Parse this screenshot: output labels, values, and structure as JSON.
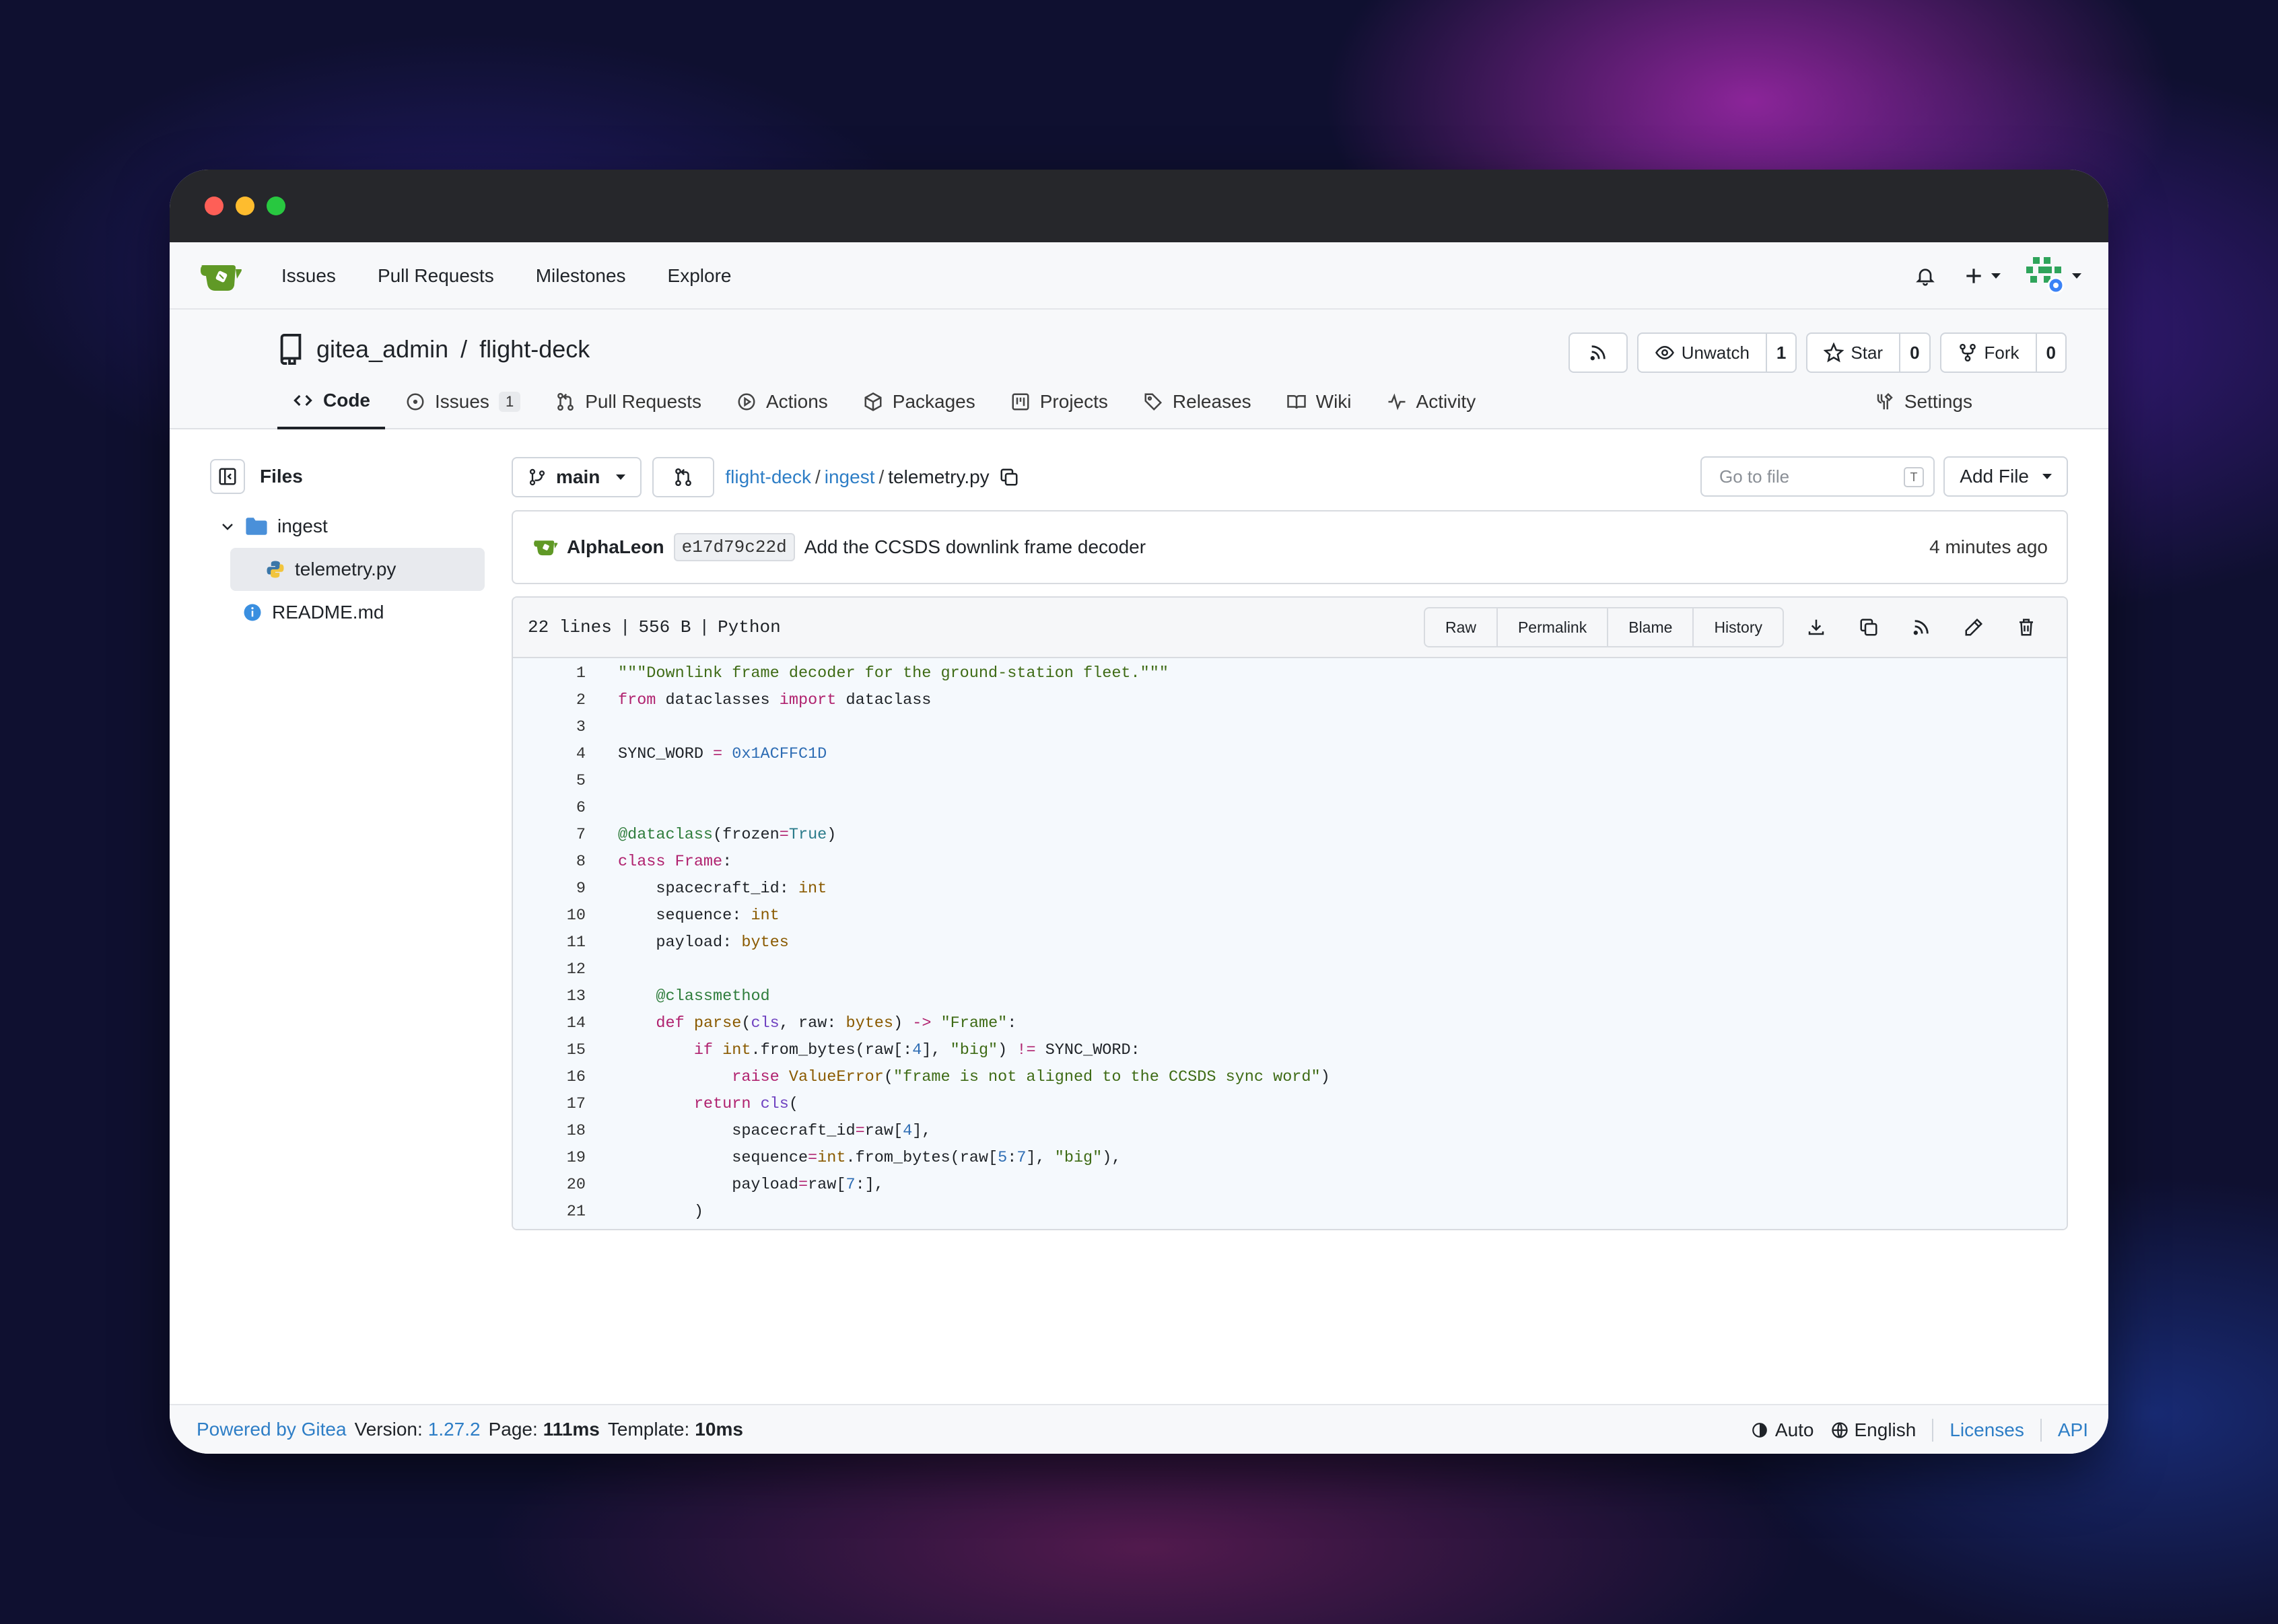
{
  "navbar": {
    "links": [
      "Issues",
      "Pull Requests",
      "Milestones",
      "Explore"
    ]
  },
  "repo": {
    "owner": "gitea_admin",
    "separator": "/",
    "name": "flight-deck",
    "actions": {
      "unwatch_label": "Unwatch",
      "unwatch_count": "1",
      "star_label": "Star",
      "star_count": "0",
      "fork_label": "Fork",
      "fork_count": "0"
    },
    "tabs": {
      "code": "Code",
      "issues": "Issues",
      "issues_count": "1",
      "pulls": "Pull Requests",
      "actions": "Actions",
      "packages": "Packages",
      "projects": "Projects",
      "releases": "Releases",
      "wiki": "Wiki",
      "activity": "Activity",
      "settings": "Settings"
    }
  },
  "files_panel": {
    "title": "Files",
    "folder": "ingest",
    "active_file": "telemetry.py",
    "readme": "README.md"
  },
  "toolbar": {
    "branch": "main",
    "crumbs": [
      "flight-deck",
      "ingest",
      "telemetry.py"
    ],
    "crumb_sep": "/",
    "goto_placeholder": "Go to file",
    "goto_key": "T",
    "add_file": "Add File"
  },
  "commit": {
    "author": "AlphaLeon",
    "sha": "e17d79c22d",
    "message": "Add the CCSDS downlink frame decoder",
    "time": "4 minutes ago"
  },
  "file": {
    "lines_info": "22 lines",
    "size": "556 B",
    "language": "Python",
    "buttons": [
      "Raw",
      "Permalink",
      "Blame",
      "History"
    ]
  },
  "code_lines": [
    "\"\"\"Downlink frame decoder for the ground-station fleet.\"\"\"",
    "from dataclasses import dataclass",
    "",
    "SYNC_WORD = 0x1ACFFC1D",
    "",
    "",
    "@dataclass(frozen=True)",
    "class Frame:",
    "    spacecraft_id: int",
    "    sequence: int",
    "    payload: bytes",
    "",
    "    @classmethod",
    "    def parse(cls, raw: bytes) -> \"Frame\":",
    "        if int.from_bytes(raw[:4], \"big\") != SYNC_WORD:",
    "            raise ValueError(\"frame is not aligned to the CCSDS sync word\")",
    "        return cls(",
    "            spacecraft_id=raw[4],",
    "            sequence=int.from_bytes(raw[5:7], \"big\"),",
    "            payload=raw[7:],",
    "        )"
  ],
  "footer": {
    "powered": "Powered by Gitea",
    "version_label": "Version:",
    "version": "1.27.2",
    "page_label": "Page:",
    "page_time": "111ms",
    "template_label": "Template:",
    "template_time": "10ms",
    "theme": "Auto",
    "language": "English",
    "licenses": "Licenses",
    "api": "API"
  },
  "colors": {
    "link": "#2e7ec6",
    "gitea_green": "#609926",
    "keyword": "#b0226f",
    "string": "#3e6b15",
    "number": "#2e6db4"
  }
}
